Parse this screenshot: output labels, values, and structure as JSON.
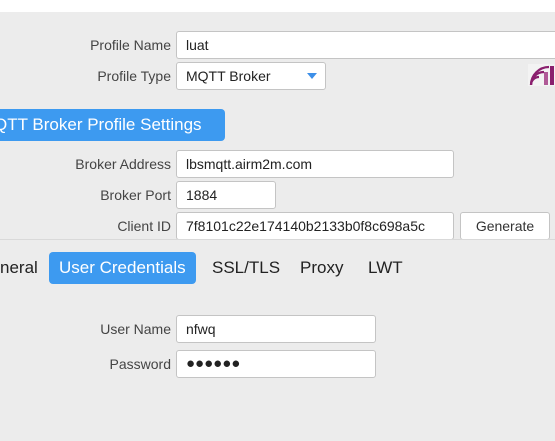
{
  "profile": {
    "name_label": "Profile Name",
    "name_value": "luat",
    "type_label": "Profile Type",
    "type_value": "MQTT Broker"
  },
  "section": {
    "title": "QTT Broker Profile Settings"
  },
  "broker": {
    "address_label": "Broker Address",
    "address_value": "lbsmqtt.airm2m.com",
    "port_label": "Broker Port",
    "port_value": "1884",
    "client_id_label": "Client ID",
    "client_id_value": "7f8101c22e174140b2133b0f8c698a5c",
    "generate_label": "Generate"
  },
  "tabs": [
    {
      "label": "neral",
      "active": false
    },
    {
      "label": "User Credentials",
      "active": true
    },
    {
      "label": "SSL/TLS",
      "active": false
    },
    {
      "label": "Proxy",
      "active": false
    },
    {
      "label": "LWT",
      "active": false
    }
  ],
  "credentials": {
    "username_label": "User Name",
    "username_value": "nfwq",
    "password_label": "Password",
    "password_value": "●●●●●●"
  },
  "colors": {
    "accent": "#3d9af0",
    "logo": "#8a1f6e"
  },
  "icons": {
    "app_logo": "mqttfx-logo-icon",
    "select_arrow": "caret-down-icon"
  }
}
